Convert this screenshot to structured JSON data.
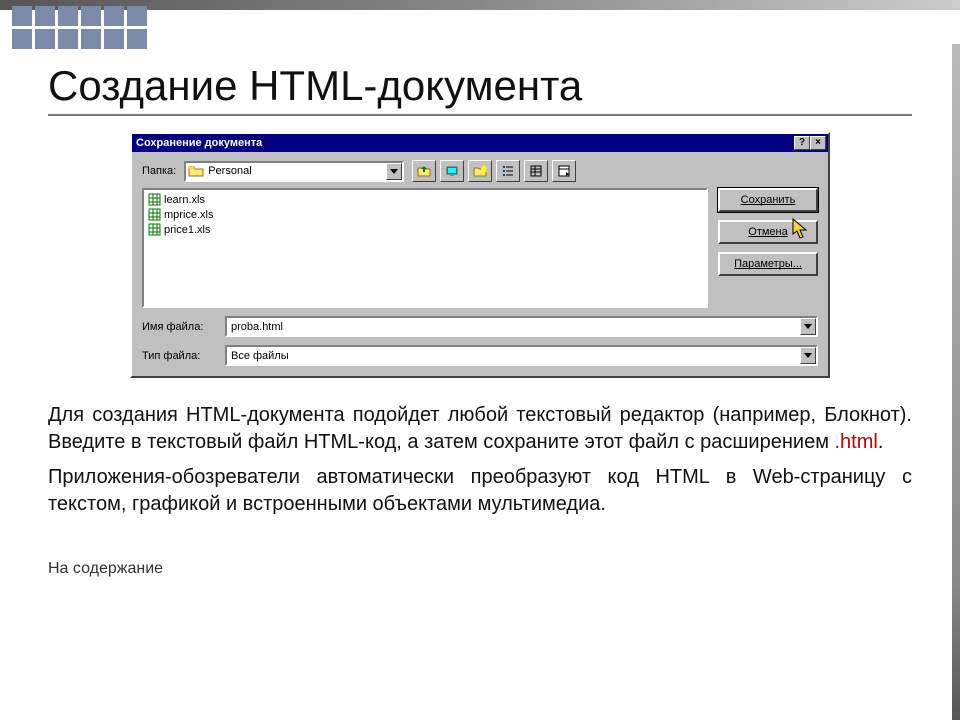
{
  "page_title": "Создание HTML-документа",
  "dialog": {
    "title": "Сохранение документа",
    "folder_label": "Папка:",
    "folder_value": "Personal",
    "toolbar_icons": [
      "up-folder-icon",
      "desktop-icon",
      "new-folder-icon",
      "list-view-icon",
      "details-view-icon",
      "commands-icon"
    ],
    "files": [
      "learn.xls",
      "mprice.xls",
      "price1.xls"
    ],
    "buttons": {
      "save": "Сохранить",
      "cancel": "Отмена",
      "options": "Параметры..."
    },
    "filename_label": "Имя файла:",
    "filename_value": "proba.html",
    "filetype_label": "Тип файла:",
    "filetype_value": "Все файлы",
    "sys_help": "?",
    "sys_close": "×"
  },
  "paragraph1_a": "Для создания HTML-документа подойдет любой текстовый редактор (например, Блокнот). Введите в текстовый файл HTML-код, а затем сохраните этот файл с расширением ",
  "paragraph1_hl": ".html",
  "paragraph1_b": ".",
  "paragraph2": " Приложения-обозреватели автоматически преобразуют код HTML в Web-страницу с текстом, графикой и встроенными объектами мультимедиа.",
  "toc_link": "На содержание"
}
